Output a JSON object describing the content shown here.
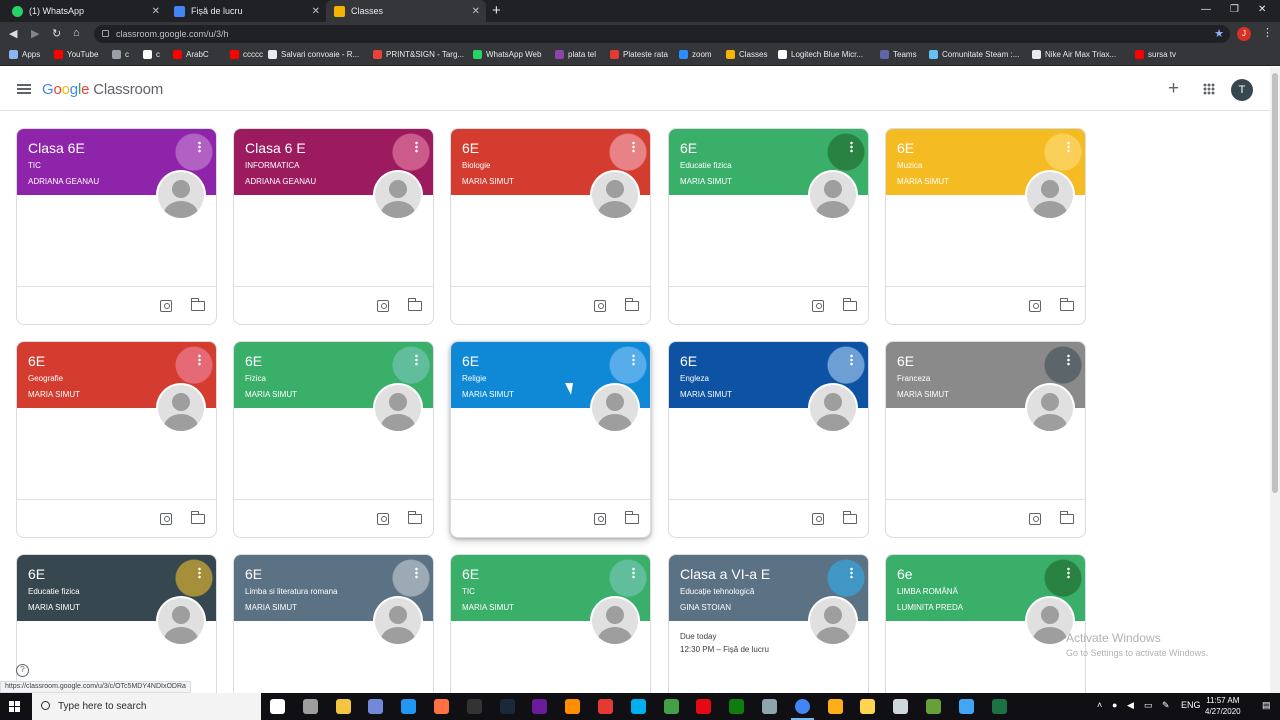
{
  "browser": {
    "tabs": [
      {
        "label": "(1) WhatsApp",
        "color": "#25d366"
      },
      {
        "label": "Fișă de lucru",
        "color": "#4285f4"
      },
      {
        "label": "Classes",
        "color": "#f4b400"
      }
    ],
    "tab_close": "✕",
    "new_tab": "+",
    "url": "classroom.google.com/u/3/h",
    "profile_initial": "J",
    "window": {
      "minimize": "—",
      "restore": "❐",
      "close": "✕"
    },
    "bookmarks": [
      {
        "label": "Apps",
        "color": "#8ab4f8"
      },
      {
        "label": "YouTube",
        "color": "#ff0000"
      },
      {
        "label": "c",
        "color": "#9aa0a6"
      },
      {
        "label": "c",
        "color": "#ffffff"
      },
      {
        "label": "ArabC",
        "color": "#ff0000"
      },
      {
        "label": "ccccc",
        "color": "#ff0000"
      },
      {
        "label": "Salvari convoaie - R...",
        "color": "#e8eaed"
      },
      {
        "label": "PRINT&SIGN - Targ...",
        "color": "#ea4335"
      },
      {
        "label": "WhatsApp Web",
        "color": "#25d366"
      },
      {
        "label": "plata tel",
        "color": "#8e44ad"
      },
      {
        "label": "Plateste rata",
        "color": "#e53935"
      },
      {
        "label": "zoom",
        "color": "#2d8cff"
      },
      {
        "label": "Classes",
        "color": "#f4b400"
      },
      {
        "label": "Logitech Blue Micr...",
        "color": "#ffffff"
      },
      {
        "label": "Teams",
        "color": "#6264a7"
      },
      {
        "label": "Comunitate Steam :...",
        "color": "#66c0f4"
      },
      {
        "label": "Nike Air Max Triax...",
        "color": "#e8eaed"
      },
      {
        "label": "sursa tv",
        "color": "#ff0000"
      }
    ]
  },
  "header": {
    "logo_google": "Google",
    "logo_classroom": "Classroom",
    "add_icon": "+",
    "account_initial": "T"
  },
  "cards": [
    {
      "title": "Clasa 6E",
      "subject": "TIC",
      "teacher": "ADRIANA GEANAU",
      "color": "#8e24aa",
      "deco": "#ce93d8"
    },
    {
      "title": "Clasa 6 E",
      "subject": "INFORMATICA",
      "teacher": "ADRIANA GEANAU",
      "color": "#9c1b5f",
      "deco": "#f48fb1"
    },
    {
      "title": "6E",
      "subject": "Biologie",
      "teacher": "MARIA SIMUT",
      "color": "#d33c2e",
      "deco": "#f8bbd0"
    },
    {
      "title": "6E",
      "subject": "Educatie fizica",
      "teacher": "MARIA SIMUT",
      "color": "#3aaf6a",
      "deco": "#1b5e20"
    },
    {
      "title": "6E",
      "subject": "Muzica",
      "teacher": "MARIA SIMUT",
      "color": "#f4bb22",
      "deco": "#ffe082"
    },
    {
      "title": "6E",
      "subject": "Geografie",
      "teacher": "MARIA SIMUT",
      "color": "#d33c2e",
      "deco": "#f48fb1"
    },
    {
      "title": "6E",
      "subject": "Fizica",
      "teacher": "MARIA SIMUT",
      "color": "#3aaf6a",
      "deco": "#80cbc4"
    },
    {
      "title": "6E",
      "subject": "Religie",
      "teacher": "MARIA SIMUT",
      "color": "#0f89d6",
      "deco": "#90caf9"
    },
    {
      "title": "6E",
      "subject": "Engleza",
      "teacher": "MARIA SIMUT",
      "color": "#0d52a3",
      "deco": "#bbdefb"
    },
    {
      "title": "6E",
      "subject": "Franceza",
      "teacher": "MARIA SIMUT",
      "color": "#8a8a8a",
      "deco": "#37474f"
    },
    {
      "title": "6E",
      "subject": "Educatie fizica",
      "teacher": "MARIA SIMUT",
      "color": "#37474f",
      "deco": "#ffca28"
    },
    {
      "title": "6E",
      "subject": "Limba si literatura romana",
      "teacher": "MARIA SIMUT",
      "color": "#5b7184",
      "deco": "#cfd8dc"
    },
    {
      "title": "6E",
      "subject": "TIC",
      "teacher": "MARIA SIMUT",
      "color": "#3aaf6a",
      "deco": "#80cbc4"
    },
    {
      "title": "Clasa a VI-a E",
      "subject": "Educație tehnologică",
      "teacher": "GINA STOIAN",
      "color": "#5b7184",
      "deco": "#29b6f6",
      "due_label": "Due today",
      "due_item": "12:30 PM – Fișă de lucru"
    },
    {
      "title": "6e",
      "subject": "LIMBA ROMÂNĂ",
      "teacher": "LUMINITA PREDA",
      "color": "#3aaf6a",
      "deco": "#1b5e20"
    }
  ],
  "watermark": {
    "line1": "Activate Windows",
    "line2": "Go to Settings to activate Windows."
  },
  "help_icon": "?",
  "status_url": "https://classroom.google.com/u/3/c/OTc5MDY4NDIxODRa",
  "taskbar": {
    "search_placeholder": "Type here to search",
    "icons": [
      {
        "name": "task-view",
        "color": "#ffffff"
      },
      {
        "name": "xbox",
        "color": "#9e9e9e"
      },
      {
        "name": "file-explorer",
        "color": "#f4c542"
      },
      {
        "name": "discord",
        "color": "#7289da"
      },
      {
        "name": "blue-app",
        "color": "#2196f3"
      },
      {
        "name": "orange-app",
        "color": "#ff7043"
      },
      {
        "name": "epic-games",
        "color": "#333333"
      },
      {
        "name": "steam",
        "color": "#1b2838"
      },
      {
        "name": "vegas",
        "color": "#6a1b9a"
      },
      {
        "name": "vlc",
        "color": "#ff8f00"
      },
      {
        "name": "red-app",
        "color": "#e53935"
      },
      {
        "name": "skype",
        "color": "#00aff0"
      },
      {
        "name": "utorrent",
        "color": "#43a047"
      },
      {
        "name": "netflix",
        "color": "#e50914"
      },
      {
        "name": "xbox-app",
        "color": "#107c10"
      },
      {
        "name": "ship-app",
        "color": "#90a4ae"
      },
      {
        "name": "chrome",
        "color": "#4285f4"
      },
      {
        "name": "rockstar",
        "color": "#fcaf17"
      },
      {
        "name": "notes",
        "color": "#ffd54f"
      },
      {
        "name": "obs",
        "color": "#cfd8dc"
      },
      {
        "name": "minecraft",
        "color": "#689f38"
      },
      {
        "name": "screen-app",
        "color": "#42a5f5"
      },
      {
        "name": "excel",
        "color": "#1e7145"
      }
    ],
    "tray": {
      "lang": "ENG",
      "time": "11:57 AM",
      "date": "4/27/2020"
    }
  }
}
